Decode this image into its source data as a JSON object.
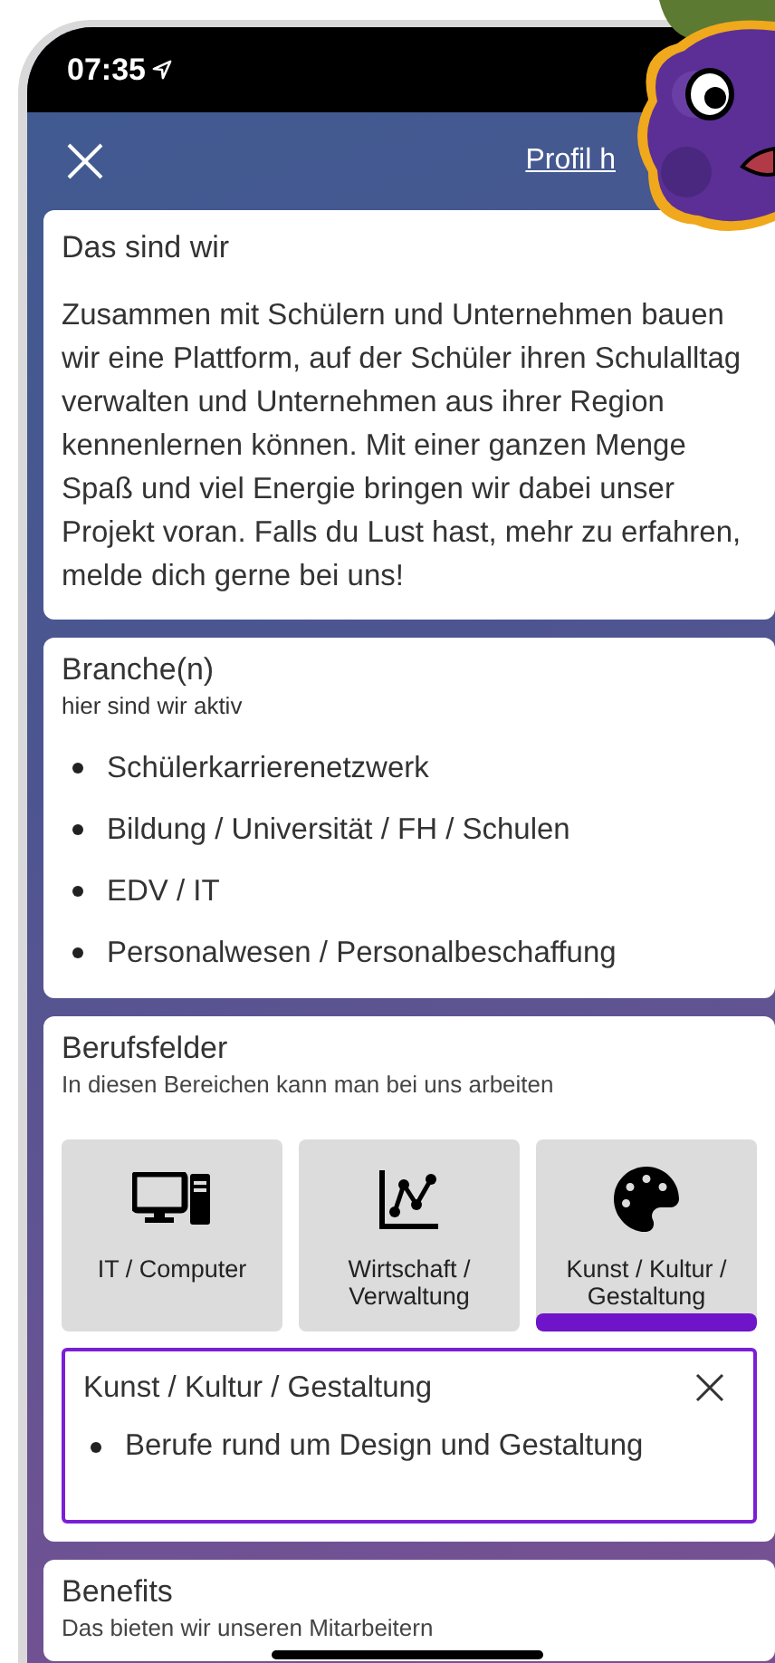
{
  "status_bar": {
    "time": "07:35"
  },
  "header": {
    "link": "Profil h"
  },
  "about": {
    "title": "Das sind wir",
    "text": "Zusammen mit Schülern und Unternehmen bauen wir eine Plattform, auf der Schüler ihren Schulalltag verwalten und Unternehmen aus ihrer Region kennenlernen können. Mit einer ganzen Menge Spaß und viel Energie bringen wir dabei unser Projekt voran. Falls du Lust hast, mehr zu erfahren, melde dich gerne bei uns!"
  },
  "branches": {
    "title": "Branche(n)",
    "subtitle": "hier sind wir aktiv",
    "items": [
      "Schülerkarrierenetzwerk",
      "Bildung / Universität / FH / Schulen",
      "EDV / IT",
      "Personalwesen / Personalbeschaffung"
    ]
  },
  "fields": {
    "title": "Berufsfelder",
    "subtitle": "In diesen Bereichen kann man bei uns arbeiten",
    "tiles": [
      {
        "kind": "computer",
        "label": "IT / Computer",
        "selected": false
      },
      {
        "kind": "chart",
        "label": "Wirtschaft / Verwaltung",
        "selected": false
      },
      {
        "kind": "palette",
        "label": "Kunst / Kultur / Gestaltung",
        "selected": true
      }
    ],
    "detail": {
      "title": "Kunst / Kultur / Gestaltung",
      "items": [
        "Berufe rund um Design und Gestaltung"
      ]
    }
  },
  "benefits": {
    "title": "Benefits",
    "subtitle": "Das bieten wir unseren Mitarbeitern"
  }
}
